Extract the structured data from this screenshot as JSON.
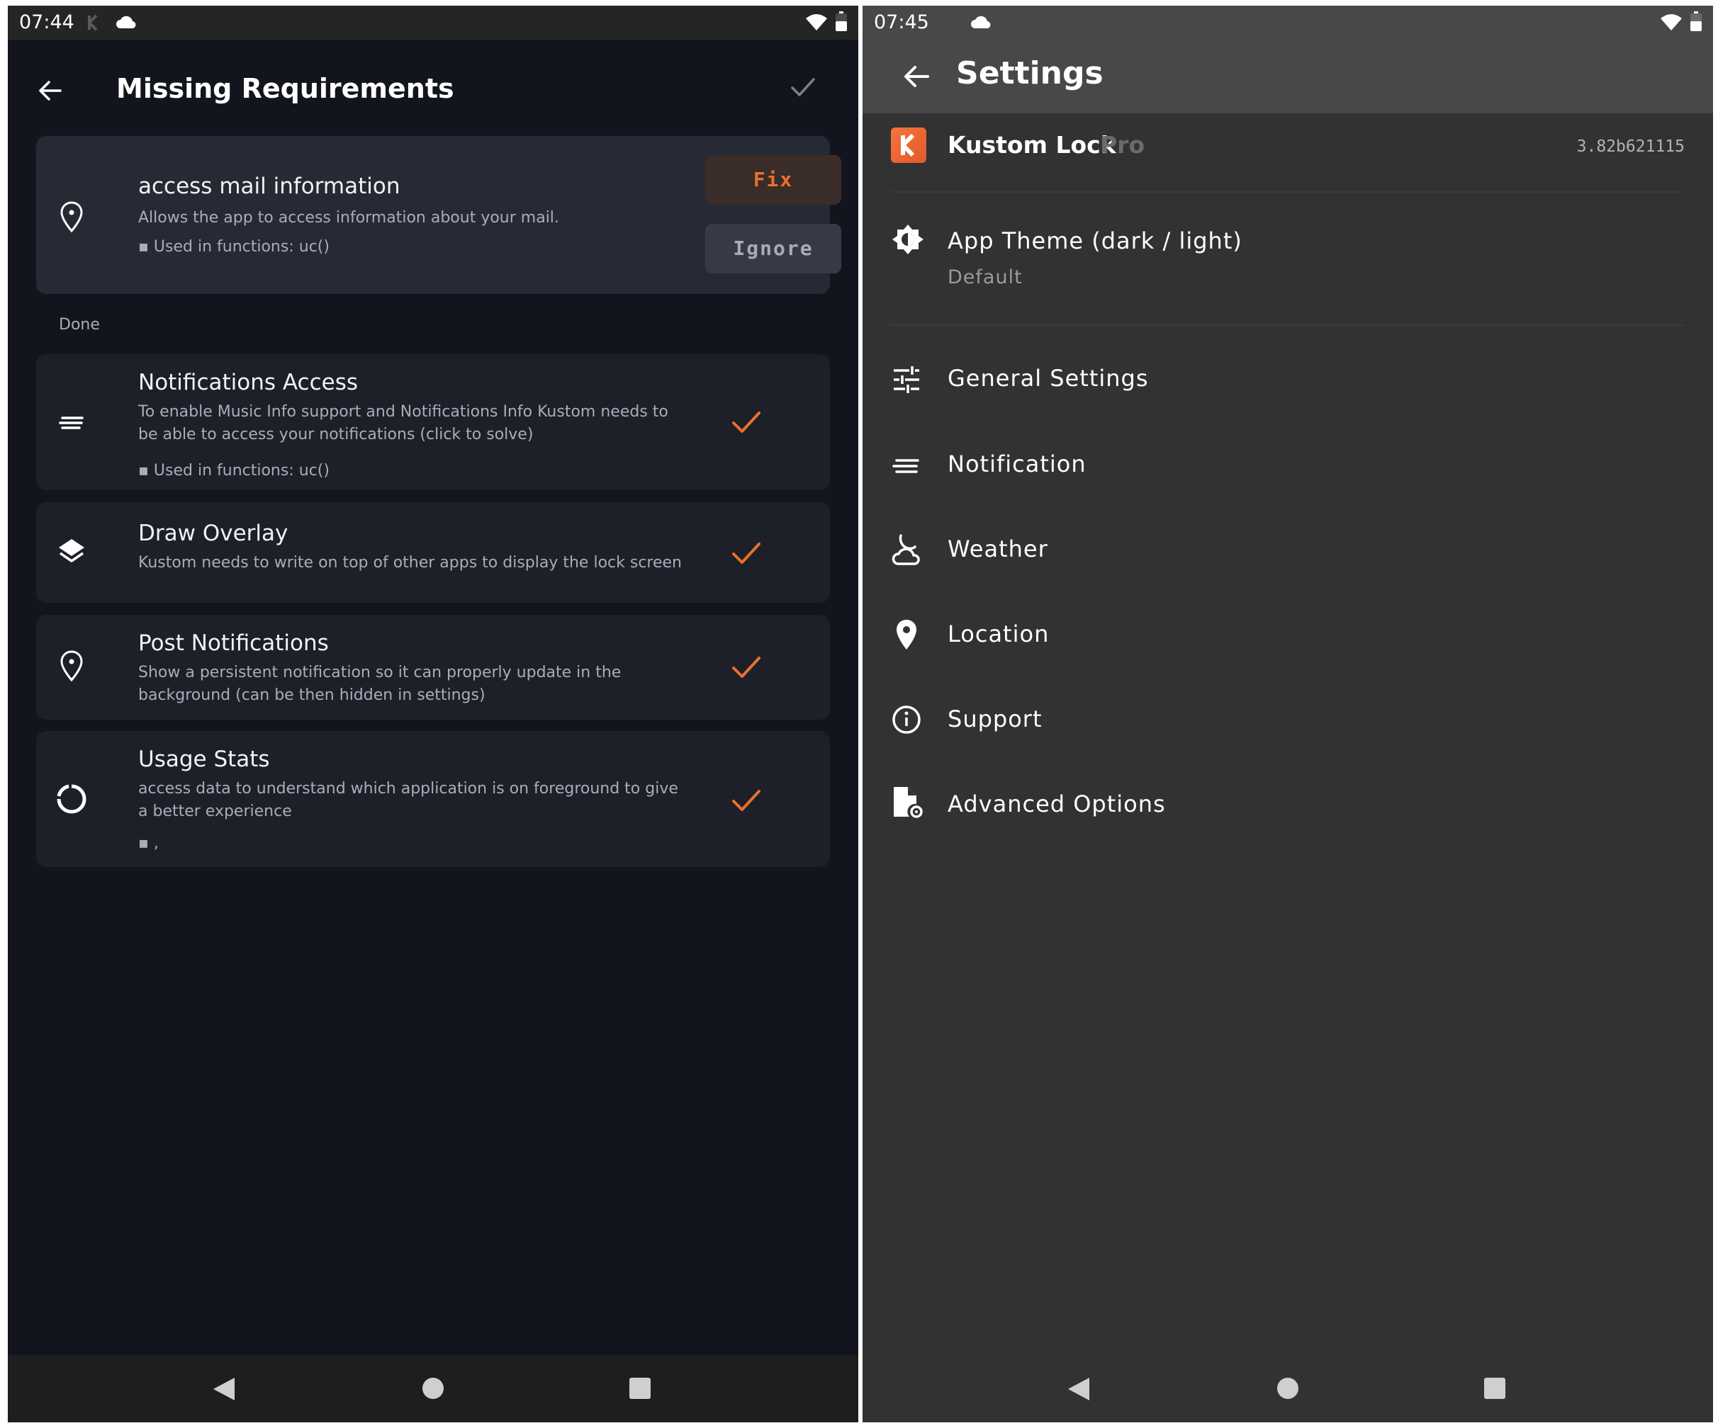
{
  "left": {
    "status_bar": {
      "time": "07:44"
    },
    "app_bar": {
      "title": "Missing Requirements"
    },
    "pending": {
      "title": "access mail information",
      "description": "Allows the app to access information about your mail.",
      "used_in": "▪ Used in functions: uc()",
      "fix_label": "Fix",
      "ignore_label": "Ignore"
    },
    "done_label": "Done",
    "done_items": [
      {
        "title": "Notifications Access",
        "description": "To enable Music Info support and Notifications Info Kustom needs to be able to access your notifications (click to solve)",
        "used_in": "▪ Used in functions: uc()",
        "icon": "notes-icon"
      },
      {
        "title": "Draw Overlay",
        "description": "Kustom needs to write on top of other apps to display the lock screen",
        "icon": "layers-icon"
      },
      {
        "title": "Post Notifications",
        "description": "Show a persistent notification so it can properly update in the background (can be then hidden in settings)",
        "icon": "location-pin-icon"
      },
      {
        "title": "Usage Stats",
        "description": "access data to understand which application is on foreground to give a better experience",
        "used_in": "▪ ,",
        "icon": "loading-circle-icon"
      }
    ]
  },
  "right": {
    "status_bar": {
      "time": "07:45"
    },
    "app_bar": {
      "title": "Settings"
    },
    "brand": {
      "name": "Kustom Lock",
      "tier": "Pro",
      "version": "3.82b621115",
      "logo_letter": "K"
    },
    "theme": {
      "label": "App Theme (dark / light)",
      "value": "Default"
    },
    "items": [
      {
        "label": "General Settings",
        "icon": "sliders-icon"
      },
      {
        "label": "Notification",
        "icon": "notification-lines-icon"
      },
      {
        "label": "Weather",
        "icon": "weather-icon"
      },
      {
        "label": "Location",
        "icon": "location-pin-icon"
      },
      {
        "label": "Support",
        "icon": "info-icon"
      },
      {
        "label": "Advanced Options",
        "icon": "file-settings-icon"
      }
    ]
  },
  "colors": {
    "accent": "#e8712c",
    "left_bg": "#12151d",
    "right_bg": "#323232"
  }
}
